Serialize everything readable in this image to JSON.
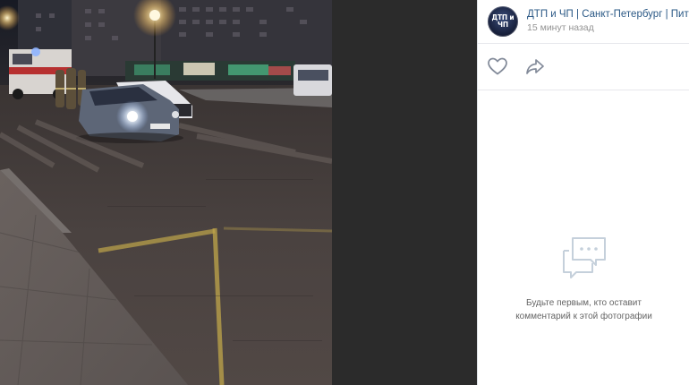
{
  "post": {
    "group_name": "ДТП и ЧП | Санкт-Петербург | Питер",
    "time": "15 минут назад",
    "avatar_text": "ДТП и ЧП"
  },
  "actions": {
    "like_icon": "heart-outline-icon",
    "share_icon": "share-arrow-icon"
  },
  "comments": {
    "empty_icon": "speech-bubbles-icon",
    "empty_line1": "Будьте первым, кто оставит",
    "empty_line2": "комментарий к этой фотографии"
  },
  "colors": {
    "link": "#2a5885",
    "muted": "#939393",
    "icon": "#828a99",
    "viewer_bg": "#2b2b2b"
  }
}
